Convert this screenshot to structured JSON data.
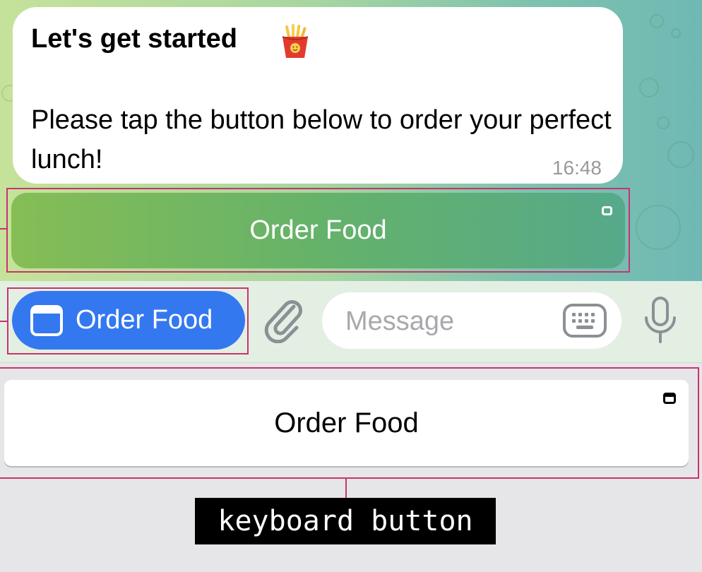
{
  "message": {
    "title": "Let's get started",
    "title_icon": "french-fries-emoji",
    "body": "Please tap the button below to order your perfect lunch!",
    "time": "16:48"
  },
  "inline_keyboard": {
    "label": "Order Food",
    "icon": "web-app-icon"
  },
  "input_bar": {
    "menu_button_label": "Order Food",
    "menu_button_icon": "web-app-icon",
    "attach_icon": "paperclip-icon",
    "placeholder": "Message",
    "keyboard_icon": "keyboard-icon",
    "mic_icon": "microphone-icon"
  },
  "reply_keyboard": {
    "label": "Order Food",
    "icon": "web-app-icon"
  },
  "annotation": {
    "caption": "keyboard button"
  },
  "colors": {
    "accent_blue": "#3478f0",
    "inline_button_green": "#65b26a",
    "highlight_border": "#c8336f"
  }
}
